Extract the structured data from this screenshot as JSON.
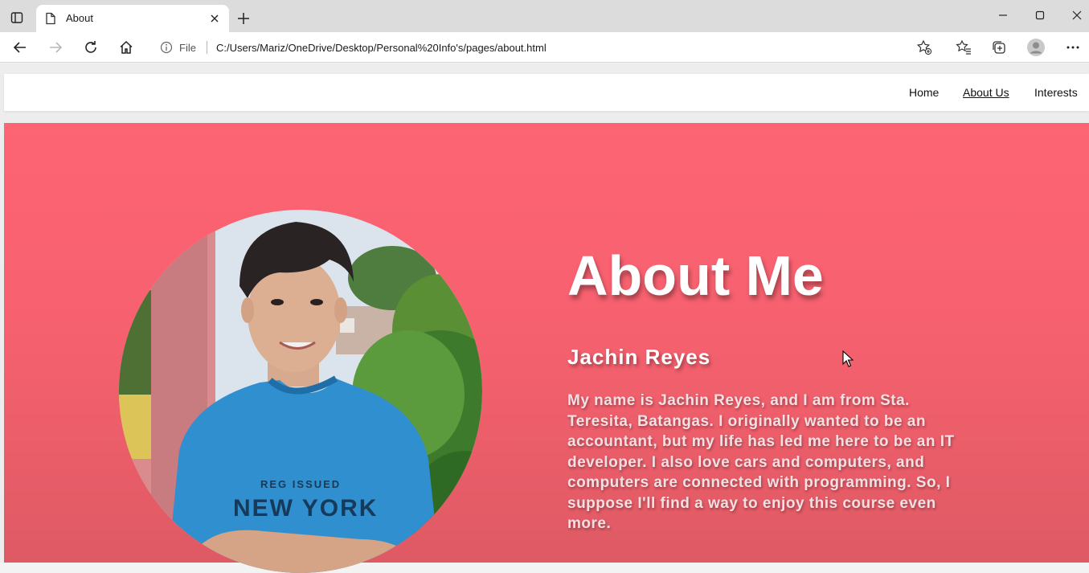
{
  "browser": {
    "tab_title": "About",
    "address": {
      "scheme_label": "File",
      "url": "C:/Users/Mariz/OneDrive/Desktop/Personal%20Info's/pages/about.html"
    },
    "icons": [
      "sidebar-icon",
      "page-icon",
      "close-icon",
      "plus-icon",
      "minimize-icon",
      "maximize-icon",
      "window-close-icon",
      "back-icon",
      "forward-icon",
      "refresh-icon",
      "home-icon",
      "info-icon",
      "add-favorite-icon",
      "favorites-icon",
      "collections-icon",
      "profile-icon",
      "more-icon"
    ]
  },
  "site": {
    "nav": {
      "home": "Home",
      "about": "About Us",
      "interests": "Interests"
    },
    "hero": {
      "title": "About Me",
      "name": "Jachin Reyes",
      "bio": "My name is Jachin Reyes, and I am from Sta. Teresita, Batangas. I originally wanted to be an accountant, but my life has led me here to be an IT developer. I also love cars and computers, and computers are connected with programming. So, I suppose I'll find a way to enjoy this course even more.",
      "shirt_text_top": "REG ISSUED",
      "shirt_text_main": "NEW YORK"
    },
    "colors": {
      "hero_top": "#fd6474",
      "hero_bottom": "#de5a64",
      "shirt": "#2f8fcf"
    }
  }
}
